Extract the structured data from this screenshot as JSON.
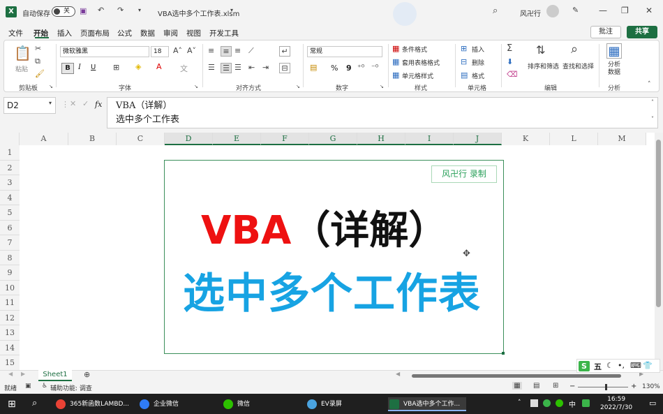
{
  "titlebar": {
    "autosave_label": "自动保存",
    "autosave_state": "关",
    "doc_title": "VBA选中多个工作表.xlsm",
    "user_name": "风卍行"
  },
  "tabs": [
    "文件",
    "开始",
    "插入",
    "页面布局",
    "公式",
    "数据",
    "审阅",
    "视图",
    "开发工具"
  ],
  "active_tab": "开始",
  "comment_button": "批注",
  "share_button": "共享",
  "ribbon": {
    "clipboard": {
      "paste": "粘贴",
      "label": "剪贴板"
    },
    "font": {
      "name": "微软雅黑",
      "size": "18",
      "bold": "B",
      "italic": "I",
      "underline": "U",
      "label": "字体"
    },
    "alignment": {
      "label": "对齐方式"
    },
    "number": {
      "format": "常规",
      "percent": "%",
      "comma": "9",
      "label": "数字"
    },
    "styles": {
      "conditional": "条件格式",
      "table": "套用表格格式",
      "cell": "单元格样式",
      "label": "样式"
    },
    "cells": {
      "insert": "插入",
      "delete": "删除",
      "format": "格式",
      "label": "单元格"
    },
    "editing": {
      "sort": "排序和筛选",
      "find": "查找和选择",
      "label": "编辑"
    },
    "analysis": {
      "button": "分析数据",
      "label": "分析"
    }
  },
  "formula_bar": {
    "name_box": "D2",
    "fx": "fx",
    "line1": "VBA（详解）",
    "line2": "选中多个工作表"
  },
  "columns": [
    "A",
    "B",
    "C",
    "D",
    "E",
    "F",
    "G",
    "H",
    "I",
    "J",
    "K",
    "L",
    "M"
  ],
  "selected_columns": [
    "D",
    "E",
    "F",
    "G",
    "H",
    "I",
    "J"
  ],
  "rows": [
    "1",
    "2",
    "3",
    "4",
    "5",
    "6",
    "7",
    "8",
    "9",
    "10",
    "11",
    "12",
    "13",
    "14",
    "15"
  ],
  "picture": {
    "stamp": "风卍行 录制",
    "title_red": "VBA",
    "title_paren": "（详解）",
    "subtitle_blue": "选中多个工作表"
  },
  "sheet_tab": "Sheet1",
  "status": {
    "ready": "就绪",
    "accessibility": "辅助功能: 调查",
    "zoom": "130%"
  },
  "taskbar": {
    "items": [
      "365新函数LAMBD...",
      "企业微信",
      "微信",
      "EV录屏",
      "VBA选中多个工作..."
    ],
    "ime": "中",
    "time": "16:59",
    "date": "2022/7/30"
  },
  "ime_toolbar": "五"
}
